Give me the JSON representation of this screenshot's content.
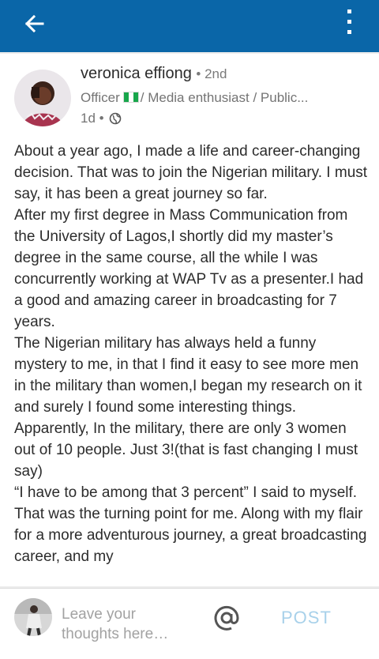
{
  "header": {
    "back_icon": "arrow-left-icon",
    "menu_icon": "more-vertical-icon",
    "color": "#0a66a8"
  },
  "post": {
    "author": "veronica effiong",
    "degree": "• 2nd",
    "headline_pre": "Officer",
    "headline_post": "/ Media enthusiast / Public...",
    "time": "1d •",
    "visibility_icon": "globe-icon",
    "paragraphs": [
      "About a year ago, I made a life and career-changing decision. That was to join the Nigerian military. I must say, it has been a great journey so far.",
      "After my first degree in Mass Communication from the University of Lagos,I shortly did my master’s degree in the same course, all the while I was concurrently working at WAP Tv as a presenter.I had a good and amazing career in broadcasting for 7 years.",
      "The Nigerian military has always held a funny mystery to me, in that I find it easy to see more men in the military than women,I began my research on it and surely I found some interesting things. Apparently, In the military, there are only 3 women out of 10 people. Just 3!(that is fast changing I must say)",
      "“I have to be among that 3 percent” I said to myself. That was the turning point for me. Along with my flair for a more adventurous journey, a great broadcasting career, and my"
    ]
  },
  "composer": {
    "placeholder": "Leave your thoughts here…",
    "mention_icon": "at-sign-icon",
    "post_label": "POST"
  }
}
